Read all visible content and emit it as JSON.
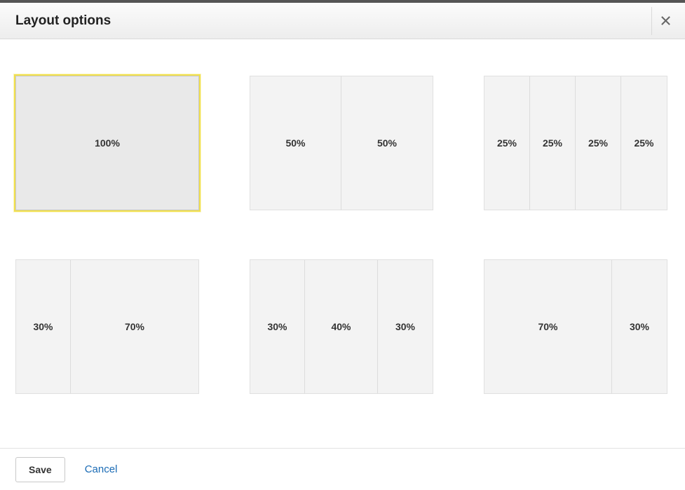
{
  "header": {
    "title": "Layout options"
  },
  "options": [
    {
      "selected": true,
      "columns": [
        "100%"
      ]
    },
    {
      "selected": false,
      "columns": [
        "50%",
        "50%"
      ]
    },
    {
      "selected": false,
      "columns": [
        "25%",
        "25%",
        "25%",
        "25%"
      ]
    },
    {
      "selected": false,
      "columns": [
        "30%",
        "70%"
      ]
    },
    {
      "selected": false,
      "columns": [
        "30%",
        "40%",
        "30%"
      ]
    },
    {
      "selected": false,
      "columns": [
        "70%",
        "30%"
      ]
    }
  ],
  "footer": {
    "save_label": "Save",
    "cancel_label": "Cancel"
  }
}
